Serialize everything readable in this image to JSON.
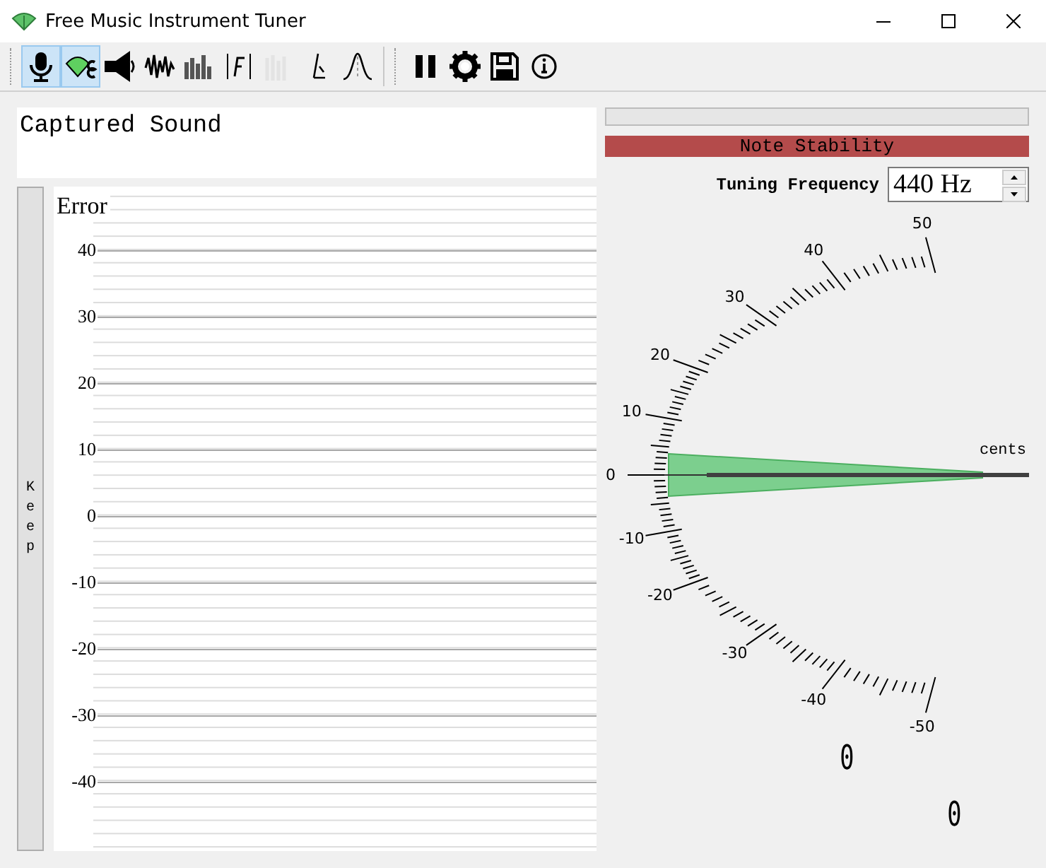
{
  "window": {
    "title": "Free Music Instrument Tuner"
  },
  "toolbar": [
    {
      "kind": "microphone",
      "selected": true,
      "disabled": false
    },
    {
      "kind": "tuner",
      "selected": true,
      "disabled": false
    },
    {
      "kind": "volume",
      "selected": false,
      "disabled": false
    },
    {
      "kind": "waveform",
      "selected": false,
      "disabled": false
    },
    {
      "kind": "spectrum",
      "selected": false,
      "disabled": false
    },
    {
      "kind": "formula",
      "selected": false,
      "disabled": false
    },
    {
      "kind": "levels",
      "selected": false,
      "disabled": true
    },
    {
      "kind": "note",
      "selected": false,
      "disabled": false
    },
    {
      "kind": "gaussian",
      "selected": false,
      "disabled": false
    },
    {
      "kind": "pause",
      "selected": false,
      "disabled": false
    },
    {
      "kind": "settings",
      "selected": false,
      "disabled": false
    },
    {
      "kind": "save",
      "selected": false,
      "disabled": false
    },
    {
      "kind": "info",
      "selected": false,
      "disabled": false
    }
  ],
  "captured_sound": {
    "title": "Captured Sound"
  },
  "keep_button": {
    "label": "Keep"
  },
  "error_plot": {
    "title": "Error",
    "y_labels": [
      "40",
      "30",
      "20",
      "10",
      "0",
      "-10",
      "-20",
      "-30",
      "-40"
    ]
  },
  "progress": {
    "level": 0
  },
  "note_stability": {
    "label": "Note Stability"
  },
  "tuning_frequency": {
    "label": "Tuning Frequency",
    "value": "440 Hz"
  },
  "gauge": {
    "unit": "cents",
    "labels": [
      "50",
      "40",
      "30",
      "20",
      "10",
      "0",
      "-10",
      "-20",
      "-30",
      "-40",
      "-50"
    ]
  },
  "readouts": [
    "0",
    "0"
  ]
}
